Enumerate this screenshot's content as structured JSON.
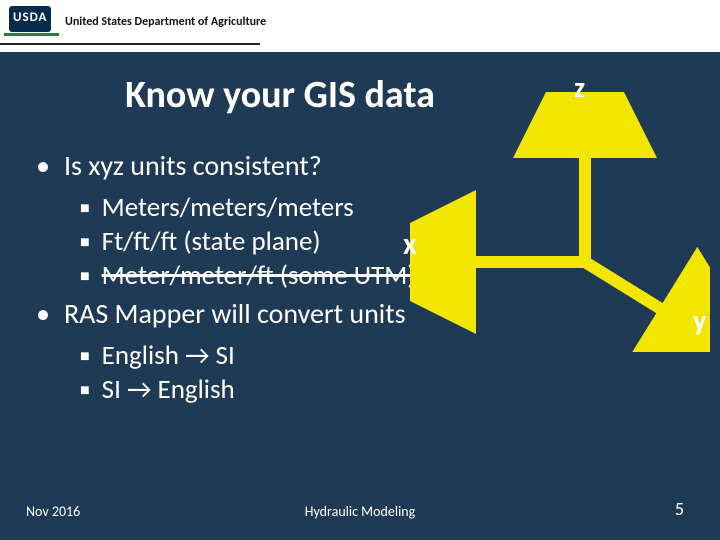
{
  "header": {
    "logo_text": "USDA",
    "department": "United States Department of Agriculture"
  },
  "title": "Know your GIS data",
  "bullets": {
    "q1": "Is xyz units consistent?",
    "q1_sub1": "Meters/meters/meters",
    "q1_sub2": "Ft/ft/ft  (state plane)",
    "q1_sub3": "Meter/meter/ft (some UTM)",
    "q2": "RAS Mapper will convert units",
    "q2_sub1": "English → SI",
    "q2_sub2": "SI → English"
  },
  "axes": {
    "z": "z",
    "x": "x",
    "y": "y"
  },
  "footer": {
    "date": "Nov 2016",
    "center": "Hydraulic Modeling",
    "page": "5"
  }
}
